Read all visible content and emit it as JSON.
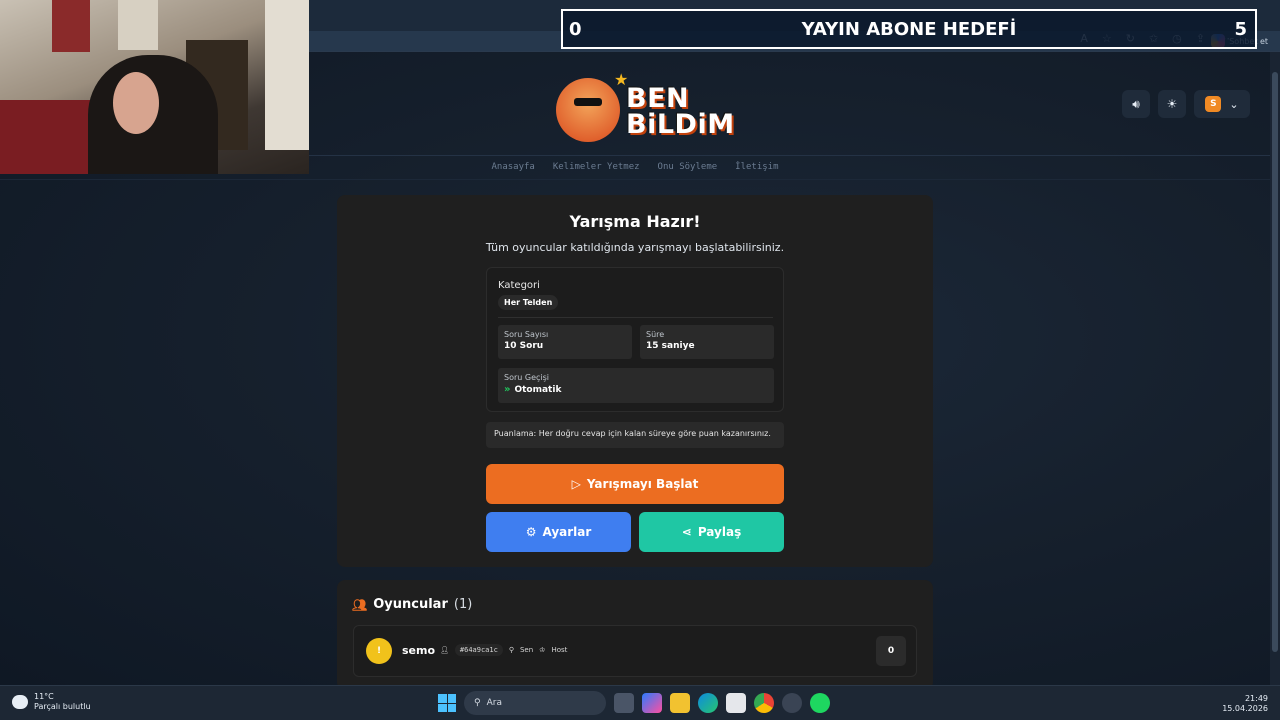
{
  "overlay": {
    "left_value": "0",
    "title": "YAYIN ABONE HEDEFİ",
    "right_value": "5"
  },
  "browser": {
    "chat_label": "Sohbet et"
  },
  "site": {
    "logo_line1": "BEN",
    "logo_line2": "BiLDiM",
    "nav": [
      "Anasayfa",
      "Kelimeler Yetmez",
      "Onu Söyleme",
      "İletişim"
    ],
    "user_initial": "S"
  },
  "card": {
    "title": "Yarışma Hazır!",
    "subtitle": "Tüm oyuncular katıldığında yarışmayı başlatabilirsiniz.",
    "category_label": "Kategori",
    "category_value": "Her Telden",
    "question_count_label": "Soru Sayısı",
    "question_count_value": "10 Soru",
    "time_label": "Süre",
    "time_value": "15 saniye",
    "transition_label": "Soru Geçişi",
    "transition_value": "Otomatik",
    "scoring_note": "Puanlama: Her doğru cevap için kalan süreye göre puan kazanırsınız.",
    "start_button": "Yarışmayı Başlat",
    "settings_button": "Ayarlar",
    "share_button": "Paylaş"
  },
  "players": {
    "title": "Oyuncular",
    "count": "(1)",
    "list": [
      {
        "avatar": "!",
        "name": "semo",
        "id": "#64a9ca1c",
        "you": "Sen",
        "host": "Host",
        "score": "0"
      }
    ]
  },
  "taskbar": {
    "temperature": "11°C",
    "weather": "Parçalı bulutlu",
    "search_placeholder": "Ara",
    "time": "21:49",
    "date": "15.04.2026"
  },
  "colors": {
    "accent_orange": "#ec6d21",
    "settings_blue": "#3f7ef0",
    "share_teal": "#1fc7a4",
    "card_bg": "#1f1f1f"
  }
}
